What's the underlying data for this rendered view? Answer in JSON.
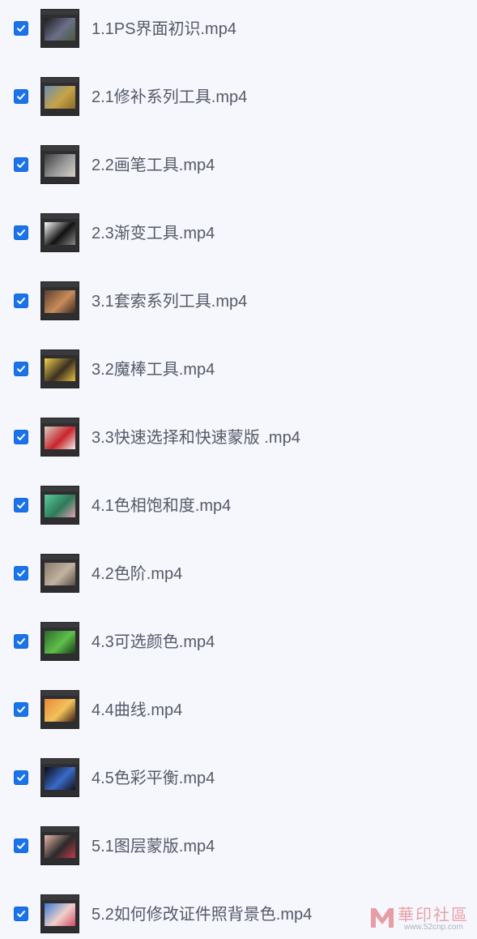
{
  "items": [
    {
      "label": "1.1PS界面初识.mp4",
      "checked": true,
      "thumb_icon": "ps-interface-thumbnail",
      "thumb_colors": [
        "#1d1d20",
        "#6b6f8a",
        "#4a5a3a"
      ]
    },
    {
      "label": "2.1修补系列工具.mp4",
      "checked": true,
      "thumb_icon": "landscape-thumbnail",
      "thumb_colors": [
        "#6a8fb3",
        "#c7a247",
        "#8a6d2a"
      ]
    },
    {
      "label": "2.2画笔工具.mp4",
      "checked": true,
      "thumb_icon": "brush-thumbnail",
      "thumb_colors": [
        "#3b3b3e",
        "#9a9a9a",
        "#d8d0c8"
      ]
    },
    {
      "label": "2.3渐变工具.mp4",
      "checked": true,
      "thumb_icon": "gradient-thumbnail",
      "thumb_colors": [
        "#ffffff",
        "#111111",
        "#888888"
      ]
    },
    {
      "label": "3.1套索系列工具.mp4",
      "checked": true,
      "thumb_icon": "lasso-thumbnail",
      "thumb_colors": [
        "#5a4030",
        "#c98b5a",
        "#3a2a22"
      ]
    },
    {
      "label": "3.2魔棒工具.mp4",
      "checked": true,
      "thumb_icon": "magic-wand-thumbnail",
      "thumb_colors": [
        "#f2d04a",
        "#3a3020",
        "#e8c040"
      ]
    },
    {
      "label": "3.3快速选择和快速蒙版 .mp4",
      "checked": true,
      "thumb_icon": "sneaker-thumbnail",
      "thumb_colors": [
        "#d9cfc4",
        "#c8242b",
        "#f4f0ea"
      ]
    },
    {
      "label": "4.1色相饱和度.mp4",
      "checked": true,
      "thumb_icon": "hue-thumbnail",
      "thumb_colors": [
        "#5ec99a",
        "#2c7a5a",
        "#e4a0b0"
      ]
    },
    {
      "label": "4.2色阶.mp4",
      "checked": true,
      "thumb_icon": "levels-thumbnail",
      "thumb_colors": [
        "#8a7a6a",
        "#c2b2a0",
        "#5a4e44"
      ]
    },
    {
      "label": "4.3可选颜色.mp4",
      "checked": true,
      "thumb_icon": "selective-color-thumbnail",
      "thumb_colors": [
        "#2d6a2a",
        "#5fbf4a",
        "#1a3a1a"
      ]
    },
    {
      "label": "4.4曲线.mp4",
      "checked": true,
      "thumb_icon": "curves-thumbnail",
      "thumb_colors": [
        "#e98a3a",
        "#f2c15a",
        "#3a1a12"
      ]
    },
    {
      "label": "4.5色彩平衡.mp4",
      "checked": true,
      "thumb_icon": "color-balance-thumbnail",
      "thumb_colors": [
        "#0a0a14",
        "#3a6ac8",
        "#121218"
      ]
    },
    {
      "label": "5.1图层蒙版.mp4",
      "checked": true,
      "thumb_icon": "layer-mask-thumbnail",
      "thumb_colors": [
        "#e8b8a8",
        "#2a2a2a",
        "#c23a4a"
      ]
    },
    {
      "label": "5.2如何修改证件照背景色.mp4",
      "checked": true,
      "thumb_icon": "id-photo-thumbnail",
      "thumb_colors": [
        "#3a7ad8",
        "#f0d0c8",
        "#d04a6a"
      ]
    }
  ],
  "watermark": {
    "title": "華印社區",
    "sub": "www.52cnp.com"
  }
}
